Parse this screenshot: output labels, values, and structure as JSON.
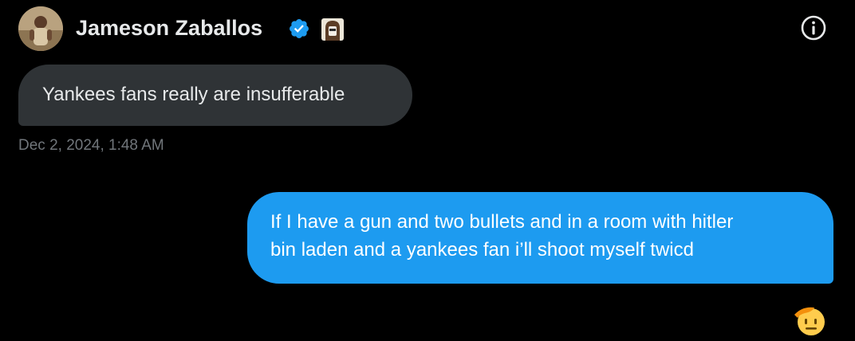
{
  "header": {
    "name": "Jameson Zaballos",
    "verified_color": "#1d9bf0",
    "icons": [
      "avatar",
      "verified-badge-icon",
      "affiliate-badge-icon",
      "info-icon"
    ]
  },
  "messages": {
    "received": {
      "text": "Yankees fans really are insufferable",
      "timestamp": "Dec 2, 2024, 1:48 AM",
      "bubble_color": "#2f3336"
    },
    "sent": {
      "line1": "If I have a gun and two bullets and in a room with hitler",
      "line2": "bin laden and a yankees fan i’ll shoot myself twicd",
      "bubble_color": "#1d9bf0",
      "reaction_icon": "saluting-face-emoji"
    }
  },
  "colors": {
    "background": "#000000",
    "text_primary": "#e7e9ea",
    "text_secondary": "#71767b",
    "accent": "#1d9bf0"
  }
}
